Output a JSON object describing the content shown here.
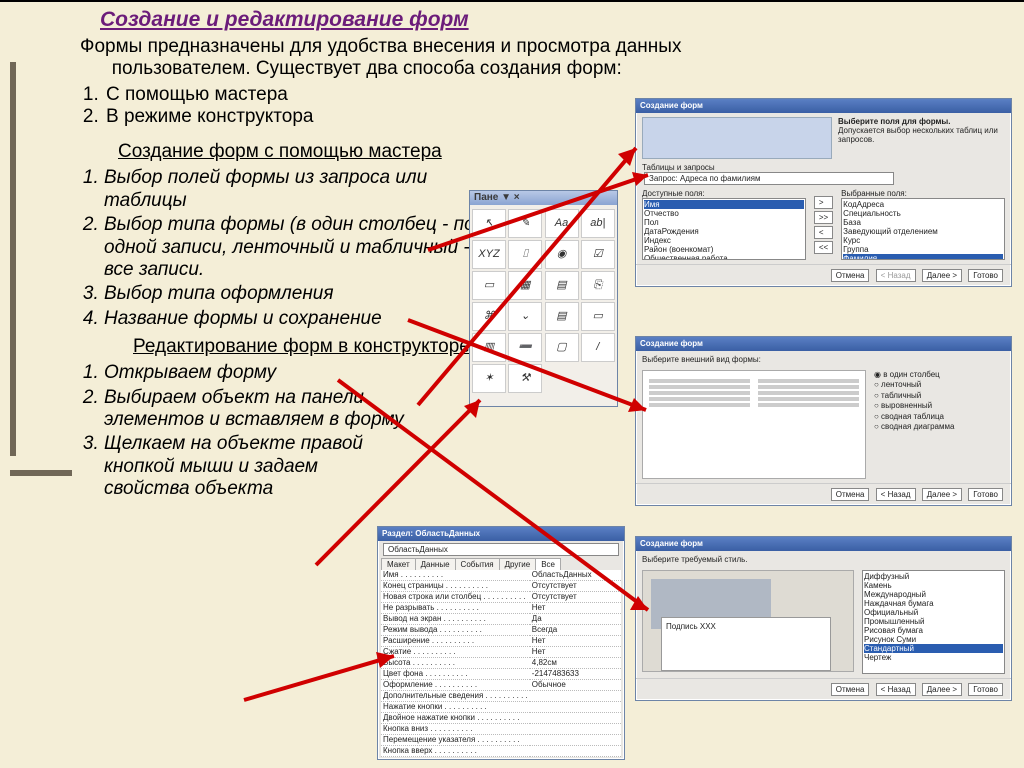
{
  "title": "Создание и редактирование форм",
  "intro_line1": "Формы предназначены для удобства внесения и просмотра данных",
  "intro_line2": "пользователем. Существует два способа создания форм:",
  "ways": [
    "С помощью мастера",
    "В режиме конструктора"
  ],
  "wizard_heading": "Создание форм с помощью мастера",
  "wizard_steps": [
    "Выбор полей формы из запроса или таблицы",
    "Выбор типа формы (в один столбец - по одной записи, ленточный и табличный - все записи.",
    "Выбор типа оформления",
    "Название формы и сохранение"
  ],
  "designer_heading": "Редактирование форм в конструкторе",
  "designer_steps": [
    "Открываем форму",
    "Выбираем объект на панели элементов и вставляем в форму",
    "Щелкаем на объекте правой кнопкой мыши и задаем свойства объекта"
  ],
  "toolbox": {
    "title": "Пане ▼ ×",
    "icons": [
      "↖",
      "✎",
      "Aa",
      "ab|",
      "XYZ",
      "⌷",
      "◉",
      "☑",
      "▭",
      "▦",
      "▤",
      "⎘",
      "⌘",
      "⌄",
      "▤",
      "▭",
      "▥",
      "➖",
      "▢",
      "/",
      "✶",
      "⚒"
    ]
  },
  "wiz1": {
    "title": "Создание форм",
    "prompt": "Выберите поля для формы.",
    "hint": "Допускается выбор нескольких таблиц или запросов.",
    "tables_label": "Таблицы и запросы",
    "tables_value": "Запрос: Адреса по фамилиям",
    "avail_label": "Доступные поля:",
    "sel_label": "Выбранные поля:",
    "avail": [
      "Имя",
      "Отчество",
      "Пол",
      "ДатаРождения",
      "Индекс",
      "Район (военкомат)",
      "Общественная работа"
    ],
    "selected": [
      "КодАдреса",
      "Специальность",
      "База",
      "Заведующий отделением",
      "Курс",
      "Группа",
      "Фамилия"
    ],
    "btn_cancel": "Отмена",
    "btn_back": "< Назад",
    "btn_next": "Далее >",
    "btn_done": "Готово"
  },
  "wiz2": {
    "title": "Создание форм",
    "prompt": "Выберите внешний вид формы:",
    "options": [
      "в один столбец",
      "ленточный",
      "табличный",
      "выровненный",
      "сводная таблица",
      "сводная диаграмма"
    ]
  },
  "wiz3": {
    "title": "Создание форм",
    "prompt": "Выберите требуемый стиль.",
    "caption": "Подпись   XXX",
    "styles": [
      "Диффузный",
      "Камень",
      "Международный",
      "Наждачная бумага",
      "Официальный",
      "Промышленный",
      "Рисовая бумага",
      "Рисунок Суми",
      "Стандартный",
      "Чертеж"
    ]
  },
  "props": {
    "title": "Раздел: ОбластьДанных",
    "combo": "ОбластьДанных",
    "tabs": [
      "Макет",
      "Данные",
      "События",
      "Другие",
      "Все"
    ],
    "rows": [
      [
        "Имя",
        "ОбластьДанных"
      ],
      [
        "Конец страницы",
        "Отсутствует"
      ],
      [
        "Новая строка или столбец",
        "Отсутствует"
      ],
      [
        "Не разрывать",
        "Нет"
      ],
      [
        "Вывод на экран",
        "Да"
      ],
      [
        "Режим вывода",
        "Всегда"
      ],
      [
        "Расширение",
        "Нет"
      ],
      [
        "Сжатие",
        "Нет"
      ],
      [
        "Высота",
        "4,82см"
      ],
      [
        "Цвет фона",
        "-2147483633"
      ],
      [
        "Оформление",
        "Обычное"
      ],
      [
        "Дополнительные сведения",
        ""
      ],
      [
        "Нажатие кнопки",
        ""
      ],
      [
        "Двойное нажатие кнопки",
        ""
      ],
      [
        "Кнопка вниз",
        ""
      ],
      [
        "Перемещение указателя",
        ""
      ],
      [
        "Кнопка вверх",
        ""
      ]
    ]
  },
  "move_btns": [
    ">",
    ">>",
    "<",
    "<<"
  ]
}
